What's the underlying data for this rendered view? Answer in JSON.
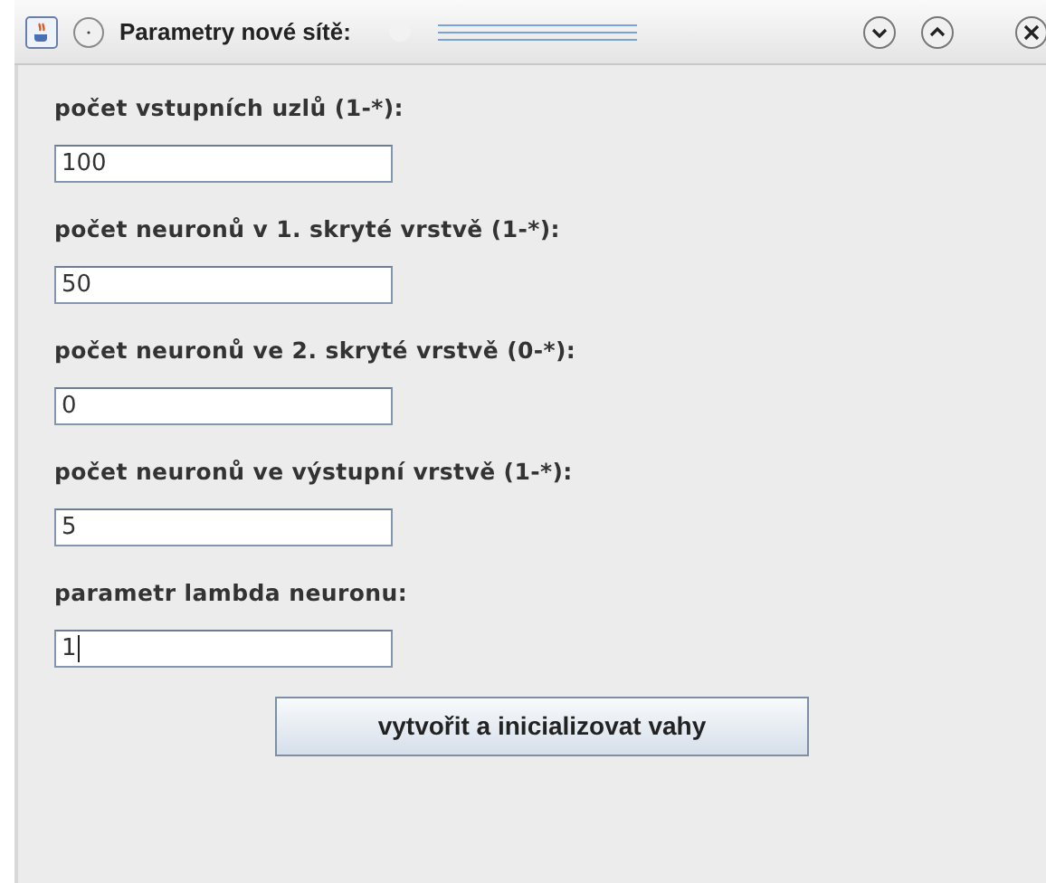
{
  "window": {
    "title": "Parametry nové sítě:"
  },
  "fields": [
    {
      "label": "počet vstupních uzlů (1-*):",
      "value": "100",
      "focused": false
    },
    {
      "label": "počet neuronů v 1. skryté vrstvě (1-*):",
      "value": "50",
      "focused": false
    },
    {
      "label": "počet neuronů ve 2. skryté vrstvě (0-*):",
      "value": "0",
      "focused": false
    },
    {
      "label": "počet neuronů ve výstupní vrstvě (1-*):",
      "value": "5",
      "focused": false
    },
    {
      "label": "parametr lambda neuronu:",
      "value": "1",
      "focused": true
    }
  ],
  "button": "vytvořit a inicializovat vahy"
}
